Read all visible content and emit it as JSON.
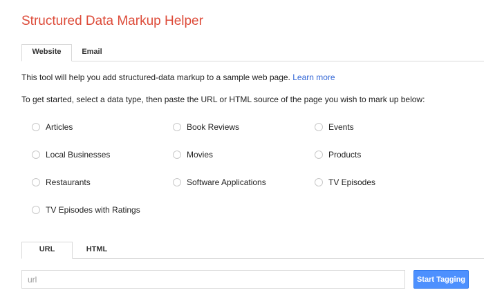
{
  "header": {
    "title": "Structured Data Markup Helper"
  },
  "source_tabs": [
    {
      "label": "Website",
      "active": true
    },
    {
      "label": "Email",
      "active": false
    }
  ],
  "intro": {
    "line1": "This tool will help you add structured-data markup to a sample web page.",
    "learn_more": "Learn more",
    "line2": "To get started, select a data type, then paste the URL or HTML source of the page you wish to mark up below:"
  },
  "data_types": [
    {
      "label": "Articles",
      "selected": false
    },
    {
      "label": "Book Reviews",
      "selected": false
    },
    {
      "label": "Events",
      "selected": false
    },
    {
      "label": "Local Businesses",
      "selected": false
    },
    {
      "label": "Movies",
      "selected": false
    },
    {
      "label": "Products",
      "selected": false
    },
    {
      "label": "Restaurants",
      "selected": false
    },
    {
      "label": "Software Applications",
      "selected": false
    },
    {
      "label": "TV Episodes",
      "selected": false
    },
    {
      "label": "TV Episodes with Ratings",
      "selected": false
    }
  ],
  "input_tabs": [
    {
      "label": "URL",
      "active": true
    },
    {
      "label": "HTML",
      "active": false
    }
  ],
  "url_field": {
    "value": "",
    "placeholder": "url"
  },
  "start_button": {
    "label": "Start Tagging"
  },
  "colors": {
    "title": "#dd4b39",
    "link": "#3367d6",
    "button": "#4d90fe"
  }
}
